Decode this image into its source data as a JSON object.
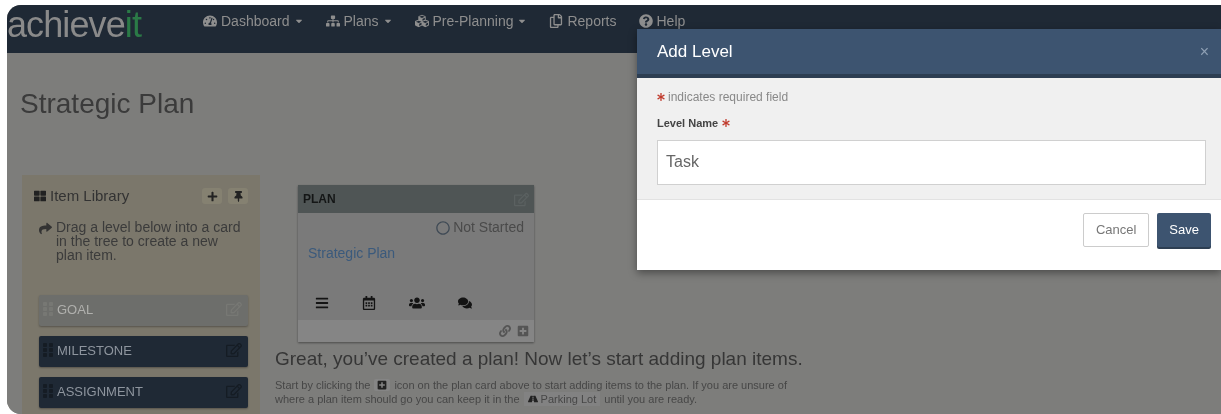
{
  "navbar": {
    "logo": {
      "main": "achieve",
      "accent": "it"
    },
    "items": [
      {
        "label": "Dashboard",
        "dropdown": true
      },
      {
        "label": "Plans",
        "dropdown": true
      },
      {
        "label": "Pre-Planning",
        "dropdown": true
      },
      {
        "label": "Reports",
        "dropdown": false
      },
      {
        "label": "Help",
        "dropdown": false
      }
    ]
  },
  "page_title": "Strategic Plan",
  "item_library": {
    "title": "Item Library",
    "hint": "Drag a level below into a card in the tree to create a new plan item.",
    "levels": [
      {
        "label": "GOAL",
        "disabled": true
      },
      {
        "label": "MILESTONE",
        "disabled": false
      },
      {
        "label": "ASSIGNMENT",
        "disabled": false
      }
    ]
  },
  "plan_card": {
    "header": "PLAN",
    "status": "Not Started",
    "name": "Strategic Plan"
  },
  "intro": {
    "heading": "Great, you’ve created a plan! Now let’s start adding plan items.",
    "part_1": "Start by clicking the",
    "part_2": "icon on the plan card above to start adding items to the plan. If you are unsure of",
    "part_2b": "where a plan item should go you can keep it in the",
    "chip": "Parking Lot",
    "part_3": "until you are ready."
  },
  "modal": {
    "title": "Add Level",
    "close": "×",
    "required_note": "indicates required field",
    "field_label": "Level Name",
    "field_value": "Task",
    "buttons": [
      {
        "label": "Cancel",
        "kind": "secondary"
      },
      {
        "label": "Save",
        "kind": "primary"
      }
    ]
  }
}
